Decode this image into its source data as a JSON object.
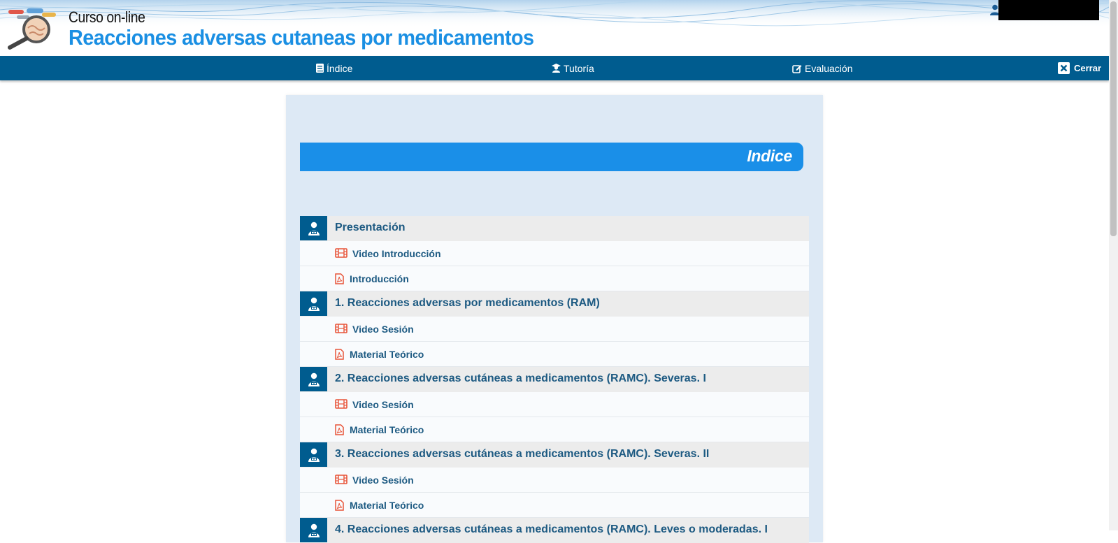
{
  "header": {
    "subtitle": "Curso on-line",
    "title": "Reacciones adversas cutaneas por medicamentos"
  },
  "nav": {
    "indice": "Índice",
    "tutoria": "Tutoría",
    "evaluacion": "Evaluación",
    "cerrar": "Cerrar"
  },
  "index_heading": "Indice",
  "sections": [
    {
      "title": "Presentación",
      "items": [
        {
          "type": "video",
          "icon": "film-icon",
          "label": "Video Introducción"
        },
        {
          "type": "pdf",
          "icon": "pdf-file-icon",
          "label": "Introducción"
        }
      ]
    },
    {
      "title": "1. Reacciones adversas por medicamentos (RAM)",
      "items": [
        {
          "type": "video",
          "icon": "film-icon",
          "label": "Video Sesión"
        },
        {
          "type": "pdf",
          "icon": "pdf-file-icon",
          "label": "Material Teórico"
        }
      ]
    },
    {
      "title": "2. Reacciones adversas cutáneas a medicamentos (RAMC). Severas. I",
      "items": [
        {
          "type": "video",
          "icon": "film-icon",
          "label": "Video Sesión"
        },
        {
          "type": "pdf",
          "icon": "pdf-file-icon",
          "label": "Material Teórico"
        }
      ]
    },
    {
      "title": "3. Reacciones adversas cutáneas a medicamentos (RAMC). Severas. II",
      "items": [
        {
          "type": "video",
          "icon": "film-icon",
          "label": "Video Sesión"
        },
        {
          "type": "pdf",
          "icon": "pdf-file-icon",
          "label": "Material Teórico"
        }
      ]
    },
    {
      "title": "4. Reacciones adversas cutáneas a medicamentos (RAMC). Leves o moderadas. I",
      "items": []
    }
  ],
  "colors": {
    "nav_bg": "#005c8f",
    "accent_blue": "#1a8fe8",
    "title_blue": "#1a8fe3",
    "link_text": "#1d5a82",
    "icon_red": "#e8553a",
    "card_bg": "#dde9f5"
  }
}
